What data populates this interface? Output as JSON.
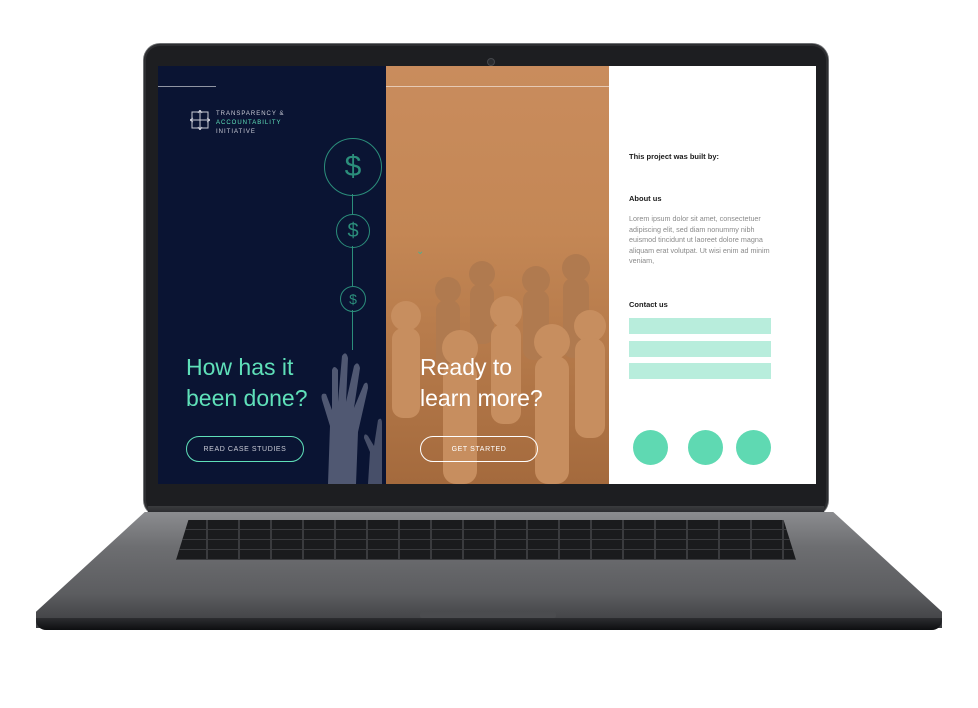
{
  "brand": {
    "line1": "TRANSPARENCY &",
    "line2": "ACCOUNTABILITY",
    "line3": "INITIATIVE"
  },
  "coins": {
    "symbol": "$"
  },
  "left_panel": {
    "headline_line1": "How has it",
    "headline_line2": "been done?",
    "button_label": "READ CASE STUDIES"
  },
  "mid_panel": {
    "headline_line1": "Ready to",
    "headline_line2": "learn more?",
    "button_label": "GET STARTED"
  },
  "right_panel": {
    "built_by_label": "This project was built by:",
    "about_title": "About us",
    "about_body": "Lorem ipsum dolor sit amet, consectetuer adipiscing elit, sed diam nonummy nibh euismod tincidunt ut laoreet dolore magna aliquam erat volutpat. Ut wisi enim ad minim veniam,",
    "contact_title": "Contact us"
  },
  "colors": {
    "navy": "#0a1433",
    "mint": "#5fe0b9",
    "copper": "#c98c5d",
    "field": "#b8eddc"
  }
}
